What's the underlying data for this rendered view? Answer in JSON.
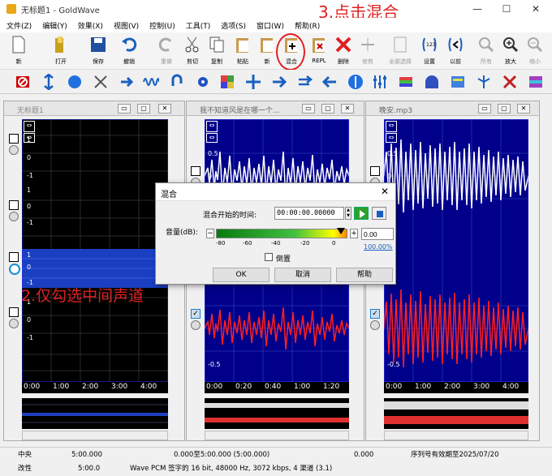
{
  "window": {
    "title": "无标题1 - GoldWave",
    "annotation_step3": "3.点击混合",
    "min": "—",
    "max": "☐",
    "close": "✕"
  },
  "menu": [
    "文件(Z)",
    "编辑(Y)",
    "效果(X)",
    "视图(V)",
    "控制(U)",
    "工具(T)",
    "选项(S)",
    "窗口(W)",
    "帮助(R)"
  ],
  "toolbar": [
    {
      "label": "新",
      "icon": "new-file-icon"
    },
    {
      "label": "打开",
      "icon": "open-folder-icon"
    },
    {
      "label": "保存",
      "icon": "save-disk-icon"
    },
    {
      "label": "撤销",
      "icon": "undo-icon"
    },
    {
      "label": "重做",
      "icon": "redo-icon"
    },
    {
      "label": "剪切",
      "icon": "scissors-icon"
    },
    {
      "label": "复制",
      "icon": "copy-icon"
    },
    {
      "label": "粘贴",
      "icon": "paste-icon"
    },
    {
      "label": "新",
      "icon": "paste-new-icon"
    },
    {
      "label": "混合",
      "icon": "mix-icon"
    },
    {
      "label": "REPL",
      "icon": "replace-icon"
    },
    {
      "label": "删除",
      "icon": "delete-x-icon"
    },
    {
      "label": "修剪",
      "icon": "trim-icon"
    },
    {
      "label": "全部选择",
      "icon": "select-all-icon"
    },
    {
      "label": "设置",
      "icon": "set-icon"
    },
    {
      "label": "以前",
      "icon": "previous-icon"
    },
    {
      "label": "所有",
      "icon": "zoom-all-icon"
    },
    {
      "label": "放大",
      "icon": "zoom-in-icon"
    },
    {
      "label": "缩小",
      "icon": "zoom-out-icon"
    }
  ],
  "windows": [
    {
      "title": "无标题1",
      "yticks": [
        "1",
        "0",
        "-1",
        "1",
        "0",
        "-1",
        "1",
        "0",
        "-1",
        "1",
        "0",
        "-1"
      ],
      "times": [
        "0:00",
        "1:00",
        "2:00",
        "3:00",
        "4:00"
      ]
    },
    {
      "title": "我不知道风是在哪一个...",
      "yticks": [
        "0.5",
        "0",
        "-0.5"
      ],
      "times": [
        "0:00",
        "0:20",
        "0:40",
        "1:00",
        "1:20"
      ]
    },
    {
      "title": "晚安.mp3",
      "yticks": [
        "0.5",
        "0",
        "-0.5"
      ],
      "times": [
        "0:00",
        "1:00",
        "2:00",
        "3:00",
        "4:00"
      ]
    }
  ],
  "annotation_step2": "2.仅勾选中间声道",
  "dialog": {
    "title": "混合",
    "close": "✕",
    "start_label": "混合开始的时间:",
    "start_value": "00:00:00.00000",
    "volume_label": "音量(dB):",
    "minus": "−",
    "plus": "+",
    "vol_value": "0.00",
    "vol_pct": "100.00%",
    "ticks": [
      "-80",
      "-60",
      "-40",
      "-20",
      "0"
    ],
    "reverse_label": "倒置",
    "ok": "OK",
    "cancel": "取消",
    "help": "帮助"
  },
  "status": {
    "r1": [
      "中央",
      "5:00.000",
      "0.000至5:00.000  (5:00.000)",
      "0.000",
      "序列号有效期至2025/07/20"
    ],
    "r2": [
      "改性",
      "5:00.0",
      "Wave PCM 签字的 16 bit, 48000 Hz, 3072 kbps, 4 渠道 (3.1)"
    ]
  }
}
